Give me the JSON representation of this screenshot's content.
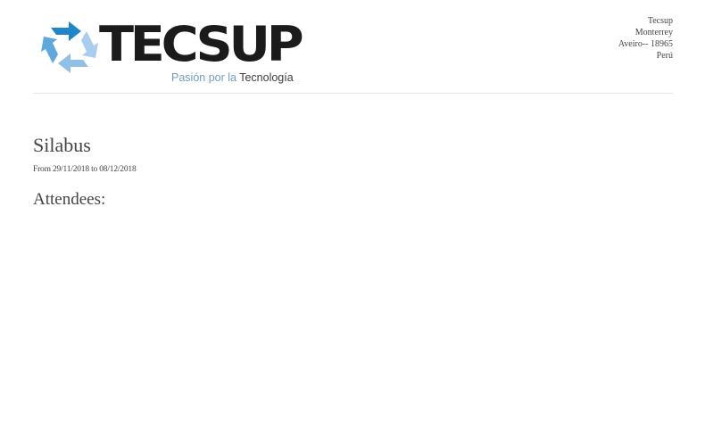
{
  "header": {
    "logo": {
      "wordmark": "TECSUP",
      "tagline_part1": "Pasión por la",
      "tagline_part2": "Tecnología",
      "colors": {
        "wordmark": "#1b1b1b",
        "tagline_accent": "#6f9cc4",
        "arrow_dark": "#1f86c9",
        "arrow_mid": "#5ea8dd",
        "arrow_light": "#a9cdee"
      }
    },
    "address": {
      "line1": "Tecsup",
      "line2": "Monterrey",
      "line3": "Aveiro-- 18965",
      "line4": "Perú"
    }
  },
  "document": {
    "title": "Silabus",
    "date_range": "From 29/11/2018 to 08/12/2018",
    "attendees_heading": "Attendees:"
  }
}
